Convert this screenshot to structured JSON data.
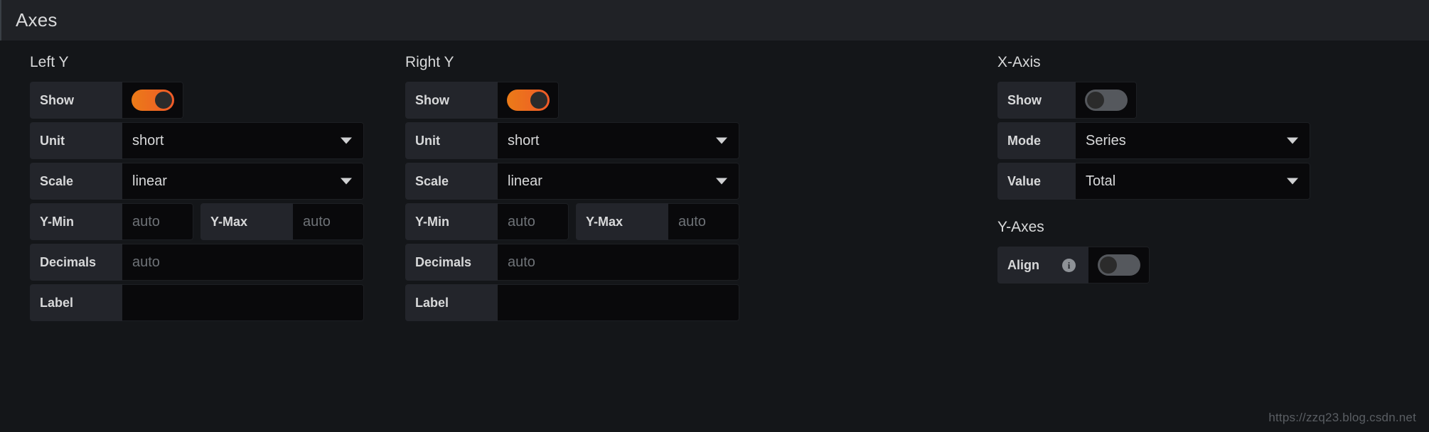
{
  "header": {
    "title": "Axes"
  },
  "colors": {
    "accent_on": "#f05a28",
    "accent_on_start": "#eb7b18",
    "toggle_off": "#55585d",
    "panel_bg": "#141619",
    "header_bg": "#202226",
    "label_bg": "#23252b",
    "input_bg": "#09090b",
    "text": "#d8d9da",
    "placeholder": "#6e7277"
  },
  "left_y": {
    "title": "Left Y",
    "rows": {
      "show": {
        "label": "Show",
        "toggle_state": "on",
        "icon": "toggle-switch-icon"
      },
      "unit": {
        "label": "Unit",
        "value": "short",
        "icon": "chevron-down-icon"
      },
      "scale": {
        "label": "Scale",
        "value": "linear",
        "icon": "chevron-down-icon"
      },
      "y_min": {
        "label": "Y-Min",
        "value": "",
        "placeholder": "auto"
      },
      "y_max": {
        "label": "Y-Max",
        "value": "",
        "placeholder": "auto"
      },
      "decimals": {
        "label": "Decimals",
        "value": "",
        "placeholder": "auto"
      },
      "label": {
        "label": "Label",
        "value": "",
        "placeholder": ""
      }
    }
  },
  "right_y": {
    "title": "Right Y",
    "rows": {
      "show": {
        "label": "Show",
        "toggle_state": "on",
        "icon": "toggle-switch-icon"
      },
      "unit": {
        "label": "Unit",
        "value": "short",
        "icon": "chevron-down-icon"
      },
      "scale": {
        "label": "Scale",
        "value": "linear",
        "icon": "chevron-down-icon"
      },
      "y_min": {
        "label": "Y-Min",
        "value": "",
        "placeholder": "auto"
      },
      "y_max": {
        "label": "Y-Max",
        "value": "",
        "placeholder": "auto"
      },
      "decimals": {
        "label": "Decimals",
        "value": "",
        "placeholder": "auto"
      },
      "label": {
        "label": "Label",
        "value": "",
        "placeholder": ""
      }
    }
  },
  "x_axis": {
    "title": "X-Axis",
    "rows": {
      "show": {
        "label": "Show",
        "toggle_state": "off",
        "icon": "toggle-switch-icon"
      },
      "mode": {
        "label": "Mode",
        "value": "Series",
        "icon": "chevron-down-icon"
      },
      "value": {
        "label": "Value",
        "value": "Total",
        "icon": "chevron-down-icon"
      }
    }
  },
  "y_axes": {
    "title": "Y-Axes",
    "rows": {
      "align": {
        "label": "Align",
        "toggle_state": "off",
        "info_icon": "info-icon",
        "info_glyph": "i"
      }
    }
  },
  "watermark": {
    "text": "https://zzq23.blog.csdn.net"
  }
}
